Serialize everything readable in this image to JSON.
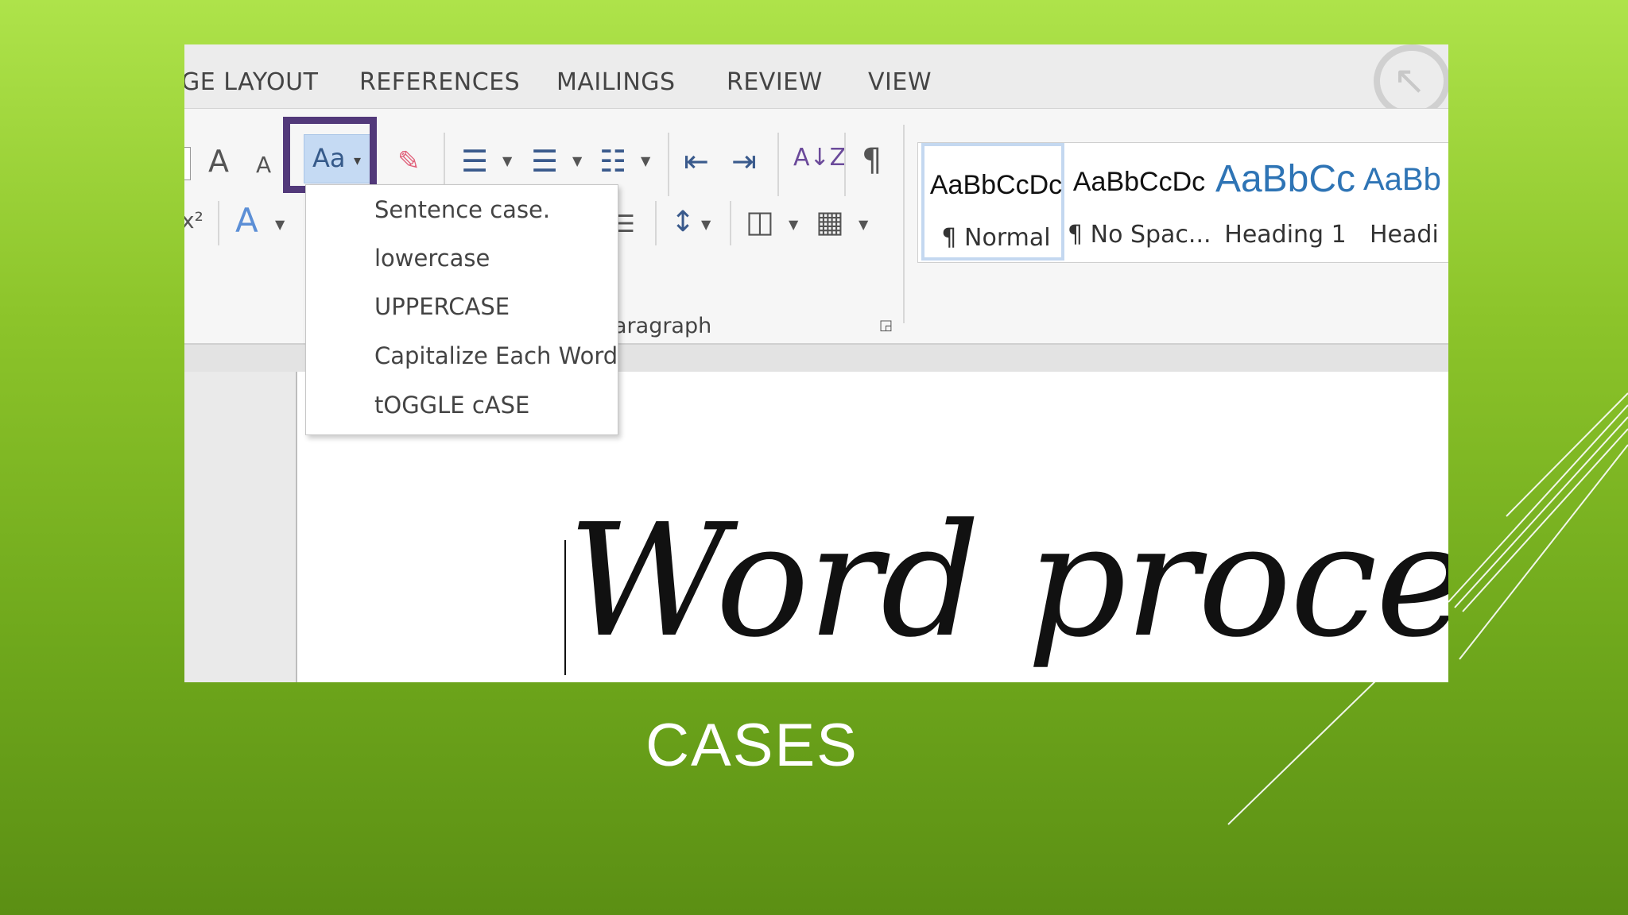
{
  "ribbon_tabs": [
    "GE LAYOUT",
    "REFERENCES",
    "MAILINGS",
    "REVIEW",
    "VIEW"
  ],
  "change_case_button": {
    "label": "Aa",
    "arrow": "▾"
  },
  "grow_font_label": "A",
  "shrink_font_label": "A",
  "superscript_label": "x²",
  "text_effects_label": "A",
  "pilcrow": "¶",
  "sort_label": "A↓Z",
  "paragraph_group_label": "aragraph",
  "styles": [
    {
      "preview": "AaBbCcDc",
      "name": "¶ Normal"
    },
    {
      "preview": "AaBbCcDc",
      "name": "¶ No Spac..."
    },
    {
      "preview": "AaBbCc",
      "name": "Heading 1"
    },
    {
      "preview": "AaBb",
      "name": "Headi"
    }
  ],
  "case_menu": [
    "Sentence case.",
    "lowercase",
    "UPPERCASE",
    "Capitalize Each Word",
    "tOGGLE cASE"
  ],
  "document_text": "Word processor",
  "caption": "CASES",
  "colors": {
    "highlight": "#52397a",
    "heading_blue": "#2e74b5",
    "background_green": "#8cc42a"
  }
}
